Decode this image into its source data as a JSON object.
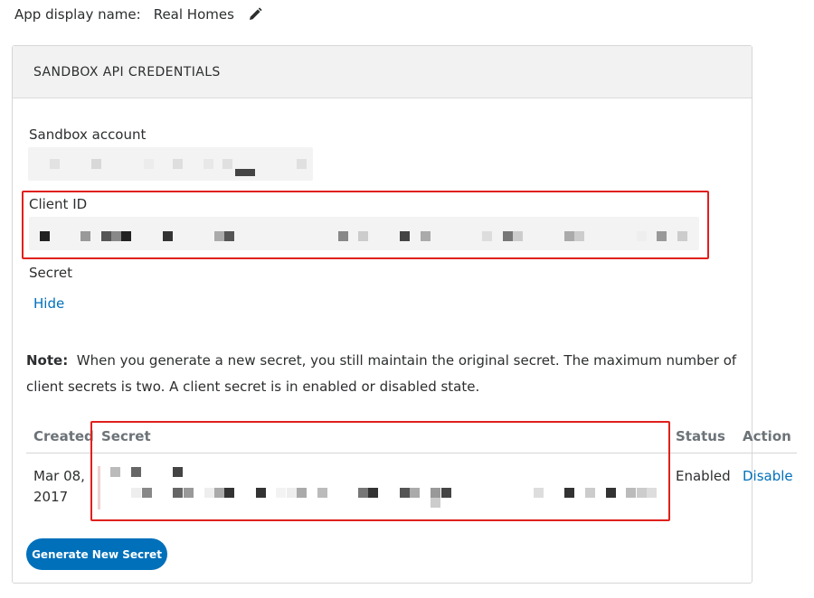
{
  "app": {
    "display_name_label": "App display name:",
    "display_name_value": "Real Homes",
    "edit_icon": "pencil-icon"
  },
  "panel": {
    "title": "SANDBOX API CREDENTIALS",
    "sandbox_account_label": "Sandbox account",
    "client_id_label": "Client ID",
    "secret_label": "Secret",
    "hide_link": "Hide"
  },
  "note": {
    "prefix": "Note:",
    "text": "When you generate a new secret, you still maintain the original secret. The maximum number of client secrets is two. A client secret is in enabled or disabled state."
  },
  "table": {
    "headers": [
      "Created",
      "Secret",
      "Status",
      "Action"
    ],
    "rows": [
      {
        "created": "Mar 08, 2017",
        "status": "Enabled",
        "action": "Disable"
      }
    ]
  },
  "buttons": {
    "generate": "Generate New Secret"
  },
  "colors": {
    "link": "#0070ba",
    "highlight_border": "#e0201c",
    "button_bg": "#0070ba"
  }
}
